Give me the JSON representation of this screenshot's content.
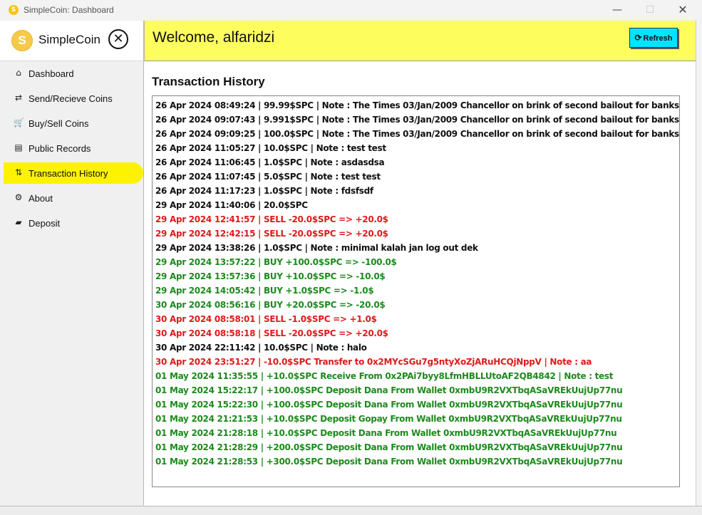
{
  "window": {
    "title": "SimpleCoin: Dashboard",
    "icon_glyph": "S",
    "minimize": "—",
    "maximize": "☐",
    "close": "✕"
  },
  "brand": {
    "logo_glyph": "S",
    "name": "SimpleCoin",
    "close_glyph": "✕"
  },
  "sidebar": {
    "items": [
      {
        "label": "Dashboard",
        "icon": "home-icon",
        "glyph": "⌂",
        "active": false
      },
      {
        "label": "Send/Recieve Coins",
        "icon": "transfer-icon",
        "glyph": "⇄",
        "active": false
      },
      {
        "label": "Buy/Sell Coins",
        "icon": "cart-icon",
        "glyph": "🛒",
        "active": false
      },
      {
        "label": "Public Records",
        "icon": "records-icon",
        "glyph": "▤",
        "active": false
      },
      {
        "label": "Transaction History",
        "icon": "history-icon",
        "glyph": "⇅",
        "active": true
      },
      {
        "label": "About",
        "icon": "gear-icon",
        "glyph": "⚙",
        "active": false
      },
      {
        "label": "Deposit",
        "icon": "wallet-icon",
        "glyph": "▰",
        "active": false
      }
    ]
  },
  "header": {
    "welcome": "Welcome, alfaridzi",
    "refresh_label": "Refresh",
    "refresh_glyph": "⟳"
  },
  "main": {
    "title": "Transaction History"
  },
  "colors": {
    "accent_yellow": "#fdf200",
    "header_yellow": "#fdfd5e",
    "refresh_cyan": "#00e5ff",
    "sell_red": "#e01a1a",
    "buy_green": "#1d8a1d"
  },
  "transactions": [
    {
      "text": "26 Apr 2024 08:49:24 | 99.99$SPC | Note : The Times 03/Jan/2009 Chancellor on brink of second bailout for banks.",
      "color": "black"
    },
    {
      "text": "26 Apr 2024 09:07:43 | 9.991$SPC | Note : The Times 03/Jan/2009 Chancellor on brink of second bailout for banks.",
      "color": "black"
    },
    {
      "text": "26 Apr 2024 09:09:25 | 100.0$SPC | Note : The Times 03/Jan/2009 Chancellor on brink of second bailout for banks.",
      "color": "black"
    },
    {
      "text": "26 Apr 2024 11:05:27 | 10.0$SPC | Note : test test",
      "color": "black"
    },
    {
      "text": "26 Apr 2024 11:06:45 | 1.0$SPC | Note : asdasdsa",
      "color": "black"
    },
    {
      "text": "26 Apr 2024 11:07:45 | 5.0$SPC | Note : test test",
      "color": "black"
    },
    {
      "text": "26 Apr 2024 11:17:23 | 1.0$SPC | Note : fdsfsdf",
      "color": "black"
    },
    {
      "text": "29 Apr 2024 11:40:06 | 20.0$SPC",
      "color": "black"
    },
    {
      "text": "29 Apr 2024 12:41:57 | SELL -20.0$SPC => +20.0$",
      "color": "red"
    },
    {
      "text": "29 Apr 2024 12:42:15 | SELL -20.0$SPC => +20.0$",
      "color": "red"
    },
    {
      "text": "29 Apr 2024 13:38:26 | 1.0$SPC | Note : minimal kalah jan log out dek",
      "color": "black"
    },
    {
      "text": "29 Apr 2024 13:57:22 | BUY +100.0$SPC => -100.0$",
      "color": "green"
    },
    {
      "text": "29 Apr 2024 13:57:36 | BUY +10.0$SPC => -10.0$",
      "color": "green"
    },
    {
      "text": "29 Apr 2024 14:05:42 | BUY +1.0$SPC => -1.0$",
      "color": "green"
    },
    {
      "text": "30 Apr 2024 08:56:16 | BUY +20.0$SPC => -20.0$",
      "color": "green"
    },
    {
      "text": "30 Apr 2024 08:58:01 | SELL -1.0$SPC => +1.0$",
      "color": "red"
    },
    {
      "text": "30 Apr 2024 08:58:18 | SELL -20.0$SPC => +20.0$",
      "color": "red"
    },
    {
      "text": "30 Apr 2024 22:11:42 | 10.0$SPC | Note : halo",
      "color": "black"
    },
    {
      "text": "30 Apr 2024 23:51:27 | -10.0$SPC Transfer to 0x2MYcSGu7g5ntyXoZjARuHCQjNppV | Note : aa",
      "color": "red"
    },
    {
      "text": "01 May 2024 11:35:55 | +10.0$SPC Receive From 0x2PAi7byy8LfmHBLLUtoAF2QB4842 | Note : test",
      "color": "green"
    },
    {
      "text": "01 May 2024 15:22:17 | +100.0$SPC Deposit Dana From Wallet 0xmbU9R2VXTbqASaVREkUujUp77nu",
      "color": "green"
    },
    {
      "text": "01 May 2024 15:22:30 | +100.0$SPC Deposit Dana From Wallet 0xmbU9R2VXTbqASaVREkUujUp77nu",
      "color": "green"
    },
    {
      "text": "01 May 2024 21:21:53 | +10.0$SPC Deposit Gopay From Wallet 0xmbU9R2VXTbqASaVREkUujUp77nu",
      "color": "green"
    },
    {
      "text": "01 May 2024 21:28:18 | +10.0$SPC Deposit Dana From Wallet 0xmbU9R2VXTbqASaVREkUujUp77nu",
      "color": "green"
    },
    {
      "text": "01 May 2024 21:28:29 | +200.0$SPC Deposit Dana From Wallet 0xmbU9R2VXTbqASaVREkUujUp77nu",
      "color": "green"
    },
    {
      "text": "01 May 2024 21:28:53 | +300.0$SPC Deposit Dana From Wallet 0xmbU9R2VXTbqASaVREkUujUp77nu",
      "color": "green"
    }
  ]
}
